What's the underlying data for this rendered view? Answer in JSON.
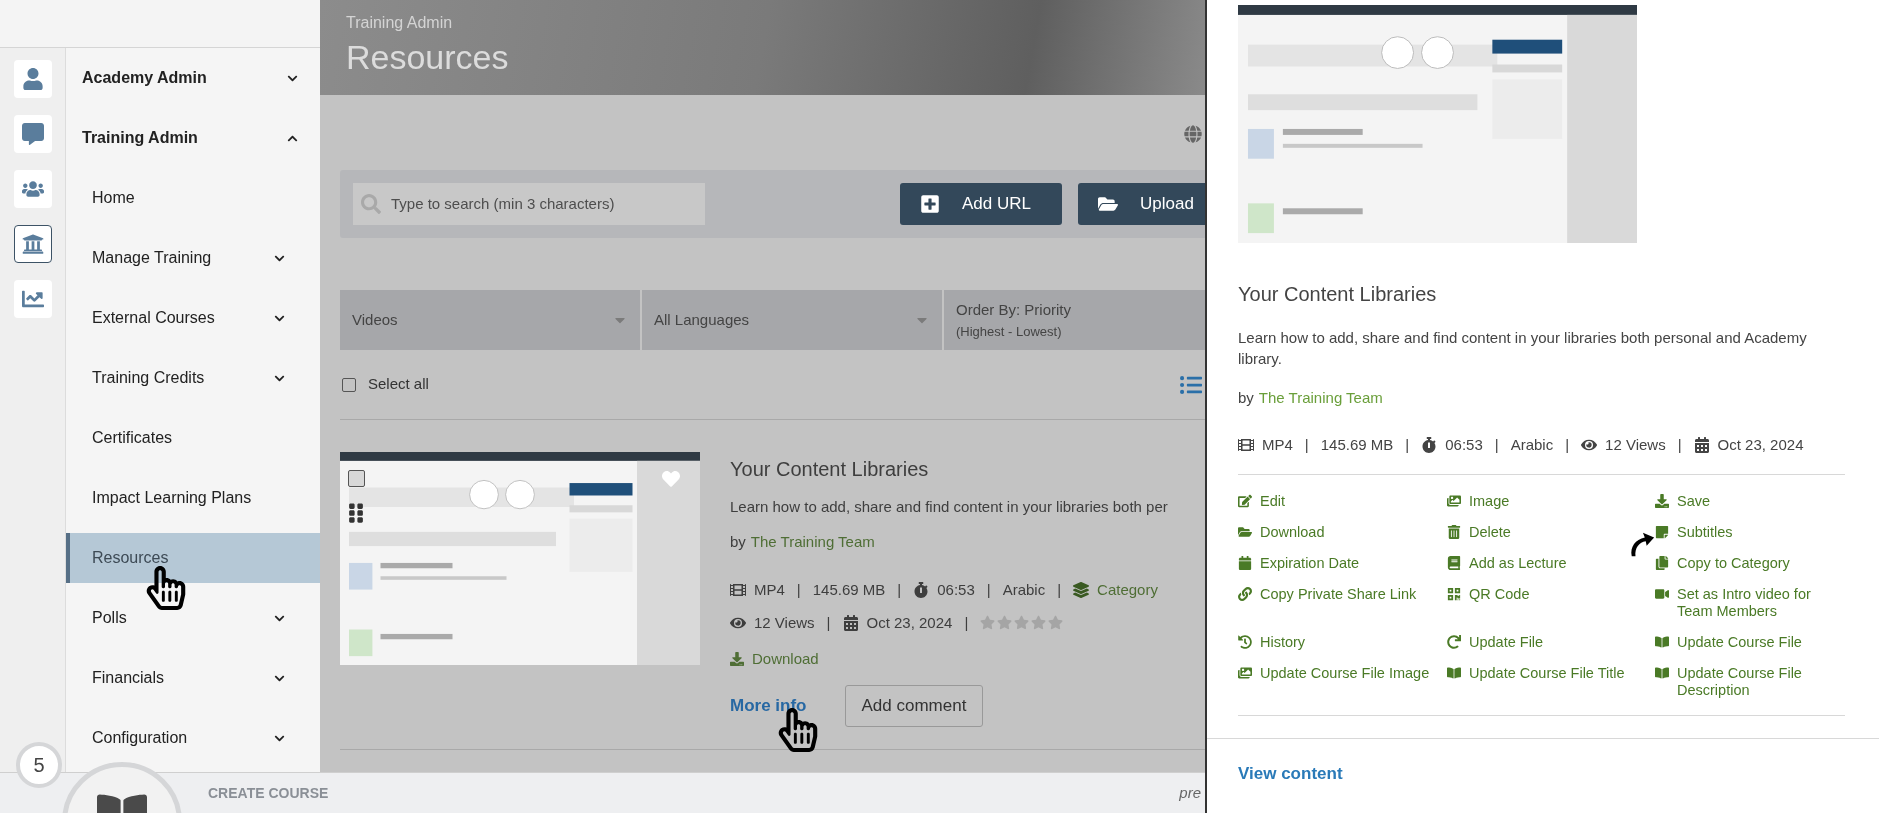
{
  "rail": [
    {
      "kind": "user",
      "selected": false
    },
    {
      "kind": "chat",
      "selected": false
    },
    {
      "kind": "users",
      "selected": false
    },
    {
      "kind": "bank",
      "selected": true
    },
    {
      "kind": "chart",
      "selected": false
    }
  ],
  "nav": [
    {
      "label": "Academy Admin",
      "expanded": false
    },
    {
      "label": "Training Admin",
      "expanded": true,
      "children": [
        {
          "label": "Home",
          "expandable": false,
          "selected": false
        },
        {
          "label": "Manage Training",
          "expandable": true,
          "selected": false
        },
        {
          "label": "External Courses",
          "expandable": true,
          "selected": false
        },
        {
          "label": "Training Credits",
          "expandable": true,
          "selected": false
        },
        {
          "label": "Certificates",
          "expandable": false,
          "selected": false
        },
        {
          "label": "Impact Learning Plans",
          "expandable": false,
          "selected": false
        },
        {
          "label": "Resources",
          "expandable": false,
          "selected": true
        },
        {
          "label": "Polls",
          "expandable": true,
          "selected": false
        },
        {
          "label": "Financials",
          "expandable": true,
          "selected": false
        },
        {
          "label": "Configuration",
          "expandable": true,
          "selected": false
        }
      ]
    }
  ],
  "header": {
    "breadcrumb": "Training Admin",
    "title": "Resources"
  },
  "toolbar": {
    "search": {
      "placeholder": "Type to search (min 3 characters)"
    },
    "buttons": [
      {
        "label": "Add URL",
        "kind": "add-url"
      },
      {
        "label": "Upload",
        "kind": "upload"
      }
    ]
  },
  "filters": [
    {
      "label": "Videos",
      "dropdown": true
    },
    {
      "label": "All Languages",
      "dropdown": true
    },
    {
      "label": "Order By: Priority",
      "sublabel": "(Highest - Lowest)"
    }
  ],
  "select_all": {
    "label": "Select all",
    "checked": false
  },
  "resource": {
    "checked": false,
    "title": "Your Content Libraries",
    "description": "Learn how to add, share and find content in your libraries both per",
    "by": "by",
    "author": "The Training Team",
    "separator": "|",
    "meta": [
      {
        "kind": "format",
        "text": "MP4"
      },
      {
        "kind": "size",
        "text": "145.69 MB"
      },
      {
        "kind": "duration",
        "text": "06:53"
      },
      {
        "kind": "language",
        "text": "Arabic"
      },
      {
        "kind": "category",
        "text": "Category"
      }
    ],
    "meta2": [
      {
        "kind": "views",
        "text": "12 Views"
      },
      {
        "kind": "date",
        "text": "Oct 23, 2024"
      }
    ],
    "stars": 0,
    "download": "Download",
    "more_info": "More info",
    "add_comment": "Add comment"
  },
  "detail": {
    "title": "Your Content Libraries",
    "description": "Learn how to add, share and find content in your libraries both personal and Academy library.",
    "by": "by",
    "author": "The Training Team",
    "separator": "|",
    "meta": [
      {
        "kind": "format",
        "text": "MP4"
      },
      {
        "kind": "size",
        "text": "145.69 MB"
      },
      {
        "kind": "duration",
        "text": "06:53"
      },
      {
        "kind": "language",
        "text": "Arabic"
      },
      {
        "kind": "views",
        "text": "12 Views"
      },
      {
        "kind": "date",
        "text": "Oct 23, 2024"
      }
    ],
    "actions": [
      {
        "kind": "edit",
        "label": "Edit"
      },
      {
        "label": "Image"
      },
      {
        "kind": "save",
        "label": "Save"
      },
      {
        "kind": "download",
        "label": "Download"
      },
      {
        "kind": "delete",
        "label": "Delete"
      },
      {
        "kind": "subtitles",
        "label": "Subtitles"
      },
      {
        "kind": "expiration",
        "label": "Expiration Date"
      },
      {
        "kind": "lecture",
        "label": "Add as Lecture"
      },
      {
        "kind": "copy",
        "label": "Copy to Category"
      },
      {
        "kind": "link",
        "label": "Copy Private Share Link"
      },
      {
        "kind": "qr",
        "label": "QR Code"
      },
      {
        "kind": "intro",
        "label": "Set as Intro video for Team Members"
      },
      {
        "kind": "history",
        "label": "History"
      },
      {
        "kind": "update",
        "label": "Update File"
      },
      {
        "kind": "course",
        "label": "Update Course File"
      },
      {
        "label": "Update Course File Image"
      },
      {
        "kind": "course",
        "label": "Update Course File Title"
      },
      {
        "kind": "course-desc",
        "label": "Update Course File Description"
      }
    ],
    "view_content": "View content"
  },
  "bottom_bar": {
    "badge": "5",
    "label": "CREATE COURSE",
    "trailing": "pre"
  }
}
